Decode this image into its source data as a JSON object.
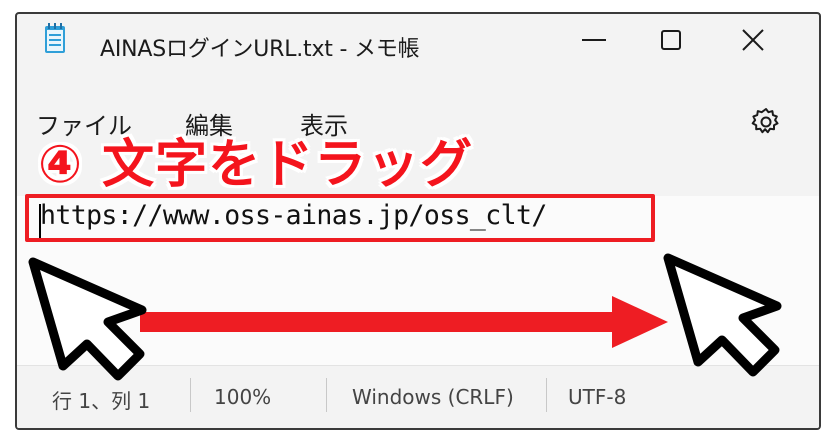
{
  "window": {
    "title": "AINASログインURL.txt - メモ帳",
    "icon": "notepad-icon",
    "controls": [
      "minimize-icon",
      "maximize-icon",
      "close-icon"
    ]
  },
  "menu": {
    "file": "ファイル",
    "edit": "編集",
    "view": "表示",
    "settings_icon": "gear-icon"
  },
  "editor": {
    "text": "https://www.oss-ainas.jp/oss_clt/"
  },
  "status": {
    "position": "行 1、列 1",
    "zoom": "100%",
    "line_ending": "Windows (CRLF)",
    "encoding": "UTF-8"
  },
  "annotation": {
    "label": "④ 文字をドラッグ",
    "color": "#f4141d",
    "icons": [
      "cursor-start-icon",
      "cursor-end-icon",
      "drag-arrow"
    ]
  }
}
